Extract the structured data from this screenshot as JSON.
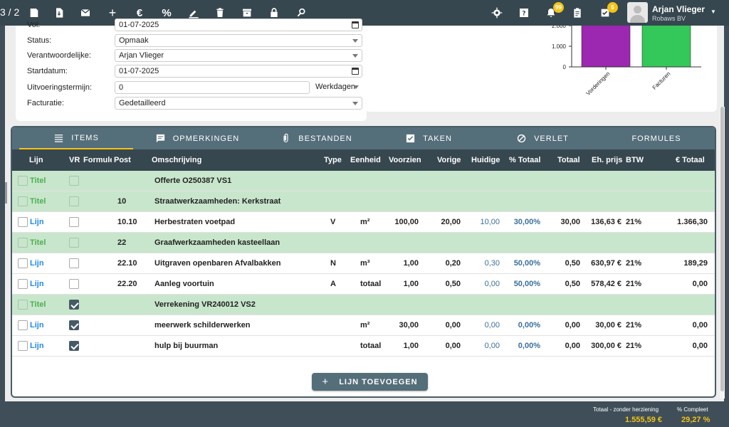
{
  "topbar": {
    "pager": "3 / 2",
    "icons": [
      "pdf-icon",
      "download-icon",
      "mail-icon",
      "plus-icon",
      "euro-icon",
      "percent-icon",
      "pen-icon",
      "trash-icon",
      "archive-icon",
      "lock-icon",
      "zoom-icon"
    ],
    "right_icons": [
      "gear-icon",
      "help-icon",
      "bell-icon",
      "clipboard-icon",
      "task-icon"
    ],
    "bell_badge": "99",
    "task_badge": "5",
    "user_name": "Arjan Vlieger",
    "user_company": "Robaws BV"
  },
  "form": {
    "top_partial_label": "Vol:",
    "top_partial_value": "01-07-2025",
    "status_label": "Status:",
    "status_value": "Opmaak",
    "owner_label": "Verantwoordelijke:",
    "owner_value": "Arjan Vlieger",
    "start_label": "Startdatum:",
    "start_value": "01-07-2025",
    "term_label": "Uitvoeringstermijn:",
    "term_value": "0",
    "term_unit": "Werkdagen",
    "billing_label": "Facturatie:",
    "billing_value": "Gedetailleerd"
  },
  "chart_data": {
    "type": "bar",
    "categories": [
      "Vorderingen",
      "Facturen"
    ],
    "values": [
      3100,
      3100
    ],
    "colors": [
      "#9c27b0",
      "#34c759"
    ],
    "yticks": [
      "0",
      "1.000",
      "2.000"
    ],
    "ylim": [
      0,
      3000
    ]
  },
  "tabs": [
    {
      "label": "ITEMS",
      "icon": "list-icon"
    },
    {
      "label": "OPMERKINGEN",
      "icon": "comment-icon"
    },
    {
      "label": "BESTANDEN",
      "icon": "paperclip-icon"
    },
    {
      "label": "TAKEN",
      "icon": "checkbox-icon"
    },
    {
      "label": "VERLET",
      "icon": "block-icon"
    },
    {
      "label": "FORMULES",
      "icon": ""
    }
  ],
  "columns": [
    "Lijn",
    "VR",
    "Formule",
    "Post",
    "Omschrijving",
    "Type",
    "Eenheid",
    "Voorzien",
    "Vorige",
    "Huidige",
    "% Totaal",
    "Totaal",
    "Eh. prijs",
    "BTW",
    "€ Totaal"
  ],
  "rows": [
    {
      "kind": "titel",
      "type_label": "Titel",
      "vr": false,
      "post": "",
      "desc": "Offerte O250387 VS1",
      "type": "",
      "unit": "",
      "voorzien": "",
      "vorige": "",
      "huidige": "",
      "pct": "",
      "totaal": "",
      "price": "",
      "btw": "",
      "eur": ""
    },
    {
      "kind": "titel",
      "type_label": "Titel",
      "vr": false,
      "post": "10",
      "desc": "Straatwerkzaamheden: Kerkstraat",
      "type": "",
      "unit": "",
      "voorzien": "",
      "vorige": "",
      "huidige": "",
      "pct": "",
      "totaal": "",
      "price": "",
      "btw": "",
      "eur": ""
    },
    {
      "kind": "lijn",
      "type_label": "Lijn",
      "vr": false,
      "post": "10.10",
      "desc": "Herbestraten voetpad",
      "type": "V",
      "unit": "m²",
      "voorzien": "100,00",
      "vorige": "20,00",
      "huidige": "10,00",
      "pct": "30,00%",
      "totaal": "30,00",
      "price": "136,63 €",
      "btw": "21%",
      "eur": "1.366,30"
    },
    {
      "kind": "titel",
      "type_label": "Titel",
      "vr": false,
      "post": "22",
      "desc": "Graafwerkzaamheden kasteellaan",
      "type": "",
      "unit": "",
      "voorzien": "",
      "vorige": "",
      "huidige": "",
      "pct": "",
      "totaal": "",
      "price": "",
      "btw": "",
      "eur": ""
    },
    {
      "kind": "lijn",
      "type_label": "Lijn",
      "vr": false,
      "post": "22.10",
      "desc": "Uitgraven openbaren Afvalbakken",
      "type": "N",
      "unit": "m³",
      "voorzien": "1,00",
      "vorige": "0,20",
      "huidige": "0,30",
      "pct": "50,00%",
      "totaal": "0,50",
      "price": "630,97 €",
      "btw": "21%",
      "eur": "189,29"
    },
    {
      "kind": "lijn",
      "type_label": "Lijn",
      "vr": false,
      "post": "22.20",
      "desc": "Aanleg voortuin",
      "type": "A",
      "unit": "totaal",
      "voorzien": "1,00",
      "vorige": "0,50",
      "huidige": "0,00",
      "pct": "50,00%",
      "totaal": "0,50",
      "price": "578,42 €",
      "btw": "21%",
      "eur": "0,00"
    },
    {
      "kind": "titel",
      "type_label": "Titel",
      "vr": true,
      "post": "",
      "desc": "Verrekening VR240012 VS2",
      "type": "",
      "unit": "",
      "voorzien": "",
      "vorige": "",
      "huidige": "",
      "pct": "",
      "totaal": "",
      "price": "",
      "btw": "",
      "eur": ""
    },
    {
      "kind": "lijn",
      "type_label": "Lijn",
      "vr": true,
      "post": "",
      "desc": "meerwerk schilderwerken",
      "type": "",
      "unit": "m²",
      "voorzien": "30,00",
      "vorige": "0,00",
      "huidige": "0,00",
      "pct": "0,00%",
      "totaal": "0,00",
      "price": "30,00 €",
      "btw": "21%",
      "eur": "0,00"
    },
    {
      "kind": "lijn",
      "type_label": "Lijn",
      "vr": true,
      "post": "",
      "desc": "hulp bij buurman",
      "type": "",
      "unit": "totaal",
      "voorzien": "1,00",
      "vorige": "0,00",
      "huidige": "0,00",
      "pct": "0,00%",
      "totaal": "0,00",
      "price": "300,00 €",
      "btw": "21%",
      "eur": "0,00"
    }
  ],
  "add_button": "LIJN TOEVOEGEN",
  "footer": {
    "total_label": "Totaal - zonder herziening",
    "total_value": "1.555,59 €",
    "pct_label": "% Compleet",
    "pct_value": "29,27 %"
  }
}
